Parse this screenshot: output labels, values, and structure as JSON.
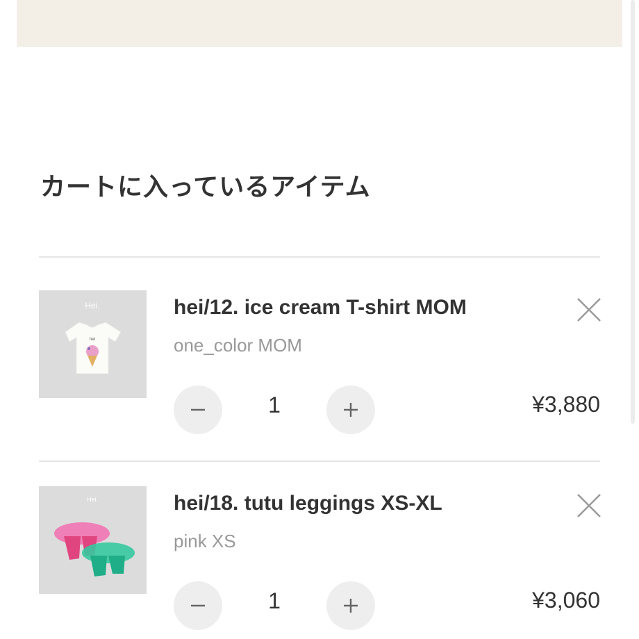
{
  "cart": {
    "title": "カートに入っているアイテム",
    "items": [
      {
        "thumbnail_brand": "Hei.",
        "name": "hei/12. ice cream T-shirt MOM",
        "variant": "one_color MOM",
        "quantity": "1",
        "price": "¥3,880",
        "decrease_icon": "minus-icon",
        "increase_icon": "plus-icon",
        "remove_icon": "close-icon"
      },
      {
        "thumbnail_brand": "Hei.",
        "name": "hei/18. tutu leggings XS-XL",
        "variant": "pink XS",
        "quantity": "1",
        "price": "¥3,060",
        "decrease_icon": "minus-icon",
        "increase_icon": "plus-icon",
        "remove_icon": "close-icon"
      }
    ]
  },
  "colors": {
    "banner": "#f4efe6",
    "text": "#333333",
    "muted": "#999999",
    "button": "#eeeeee",
    "divider": "#e6e6e6"
  }
}
